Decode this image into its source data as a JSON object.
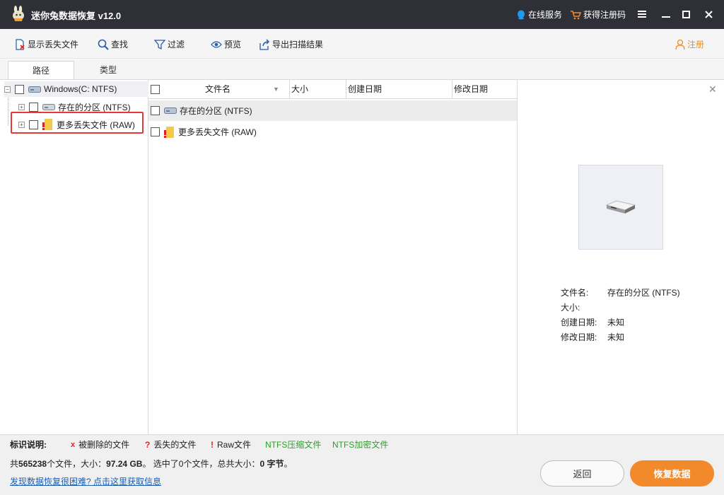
{
  "title_bar": {
    "app_title": "迷你兔数据恢复 v12.0",
    "online_service": "在线服务",
    "get_code": "获得注册码"
  },
  "toolbar": {
    "show_lost": "显示丢失文件",
    "find": "查找",
    "filter": "过滤",
    "preview": "预览",
    "export": "导出扫描结果",
    "register": "注册"
  },
  "tabs": [
    "路径",
    "类型"
  ],
  "tree": {
    "root": "Windows(C: NTFS)",
    "children": [
      {
        "label": "存在的分区 (NTFS)",
        "icon": "drive-icon"
      },
      {
        "label": "更多丢失文件 (RAW)",
        "icon": "lost-folder-icon"
      }
    ]
  },
  "file_list": {
    "columns": [
      "文件名",
      "大小",
      "创建日期",
      "修改日期"
    ],
    "rows": [
      {
        "name": "存在的分区 (NTFS)",
        "icon": "drive-icon"
      },
      {
        "name": "更多丢失文件 (RAW)",
        "icon": "lost-folder-icon"
      }
    ]
  },
  "preview": {
    "info": [
      {
        "label": "文件名:",
        "value": "存在的分区 (NTFS)"
      },
      {
        "label": "大小:",
        "value": ""
      },
      {
        "label": "创建日期:",
        "value": "未知"
      },
      {
        "label": "修改日期:",
        "value": "未知"
      }
    ]
  },
  "legend": {
    "title": "标识说明:",
    "deleted": "被删除的文件",
    "lost": "丢失的文件",
    "raw": "Raw文件",
    "ntfs_compressed": "NTFS压缩文件",
    "ntfs_encrypted": "NTFS加密文件",
    "deleted_mark": "x",
    "lost_mark": "?",
    "raw_mark": "!"
  },
  "status": {
    "summary_prefix": "共",
    "total_files": "565238",
    "summary_mid1": "个文件，大小：",
    "total_size": "97.24 GB",
    "summary_mid2": "。 选中了0个文件，总共大小：",
    "selected_size": "0 字节",
    "summary_end": "。",
    "help_link": "发现数据恢复很困难? 点击这里获取信息"
  },
  "buttons": {
    "back": "返回",
    "recover": "恢复数据"
  },
  "colors": {
    "titlebar": "#2e2f37",
    "accent_orange": "#f28a2b",
    "highlight_red": "#e53935",
    "legend_green": "#2aa02a"
  }
}
